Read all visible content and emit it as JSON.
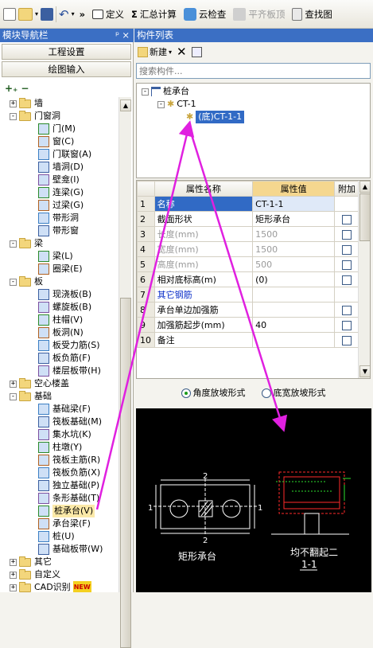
{
  "toolbar": {
    "more": "»",
    "define": "定义",
    "sum_calc": "汇总计算",
    "cloud_check": "云检查",
    "flush_slab_top": "平齐板顶",
    "find_replace": "查找图"
  },
  "left_panel": {
    "title": "模块导航栏",
    "pin": "ᵖ",
    "close": "×",
    "project_settings": "工程设置",
    "drawing_input": "绘图输入",
    "tree": [
      {
        "type": "folder",
        "expand": "+",
        "label": "墙"
      },
      {
        "type": "folder",
        "expand": "-",
        "label": "门窗洞"
      },
      {
        "type": "item",
        "label": "门(M)"
      },
      {
        "type": "item",
        "label": "窗(C)"
      },
      {
        "type": "item",
        "label": "门联窗(A)"
      },
      {
        "type": "item",
        "label": "墙洞(D)"
      },
      {
        "type": "item",
        "label": "壁龛(I)"
      },
      {
        "type": "item",
        "label": "连梁(G)"
      },
      {
        "type": "item",
        "label": "过梁(G)"
      },
      {
        "type": "item",
        "label": "带形洞"
      },
      {
        "type": "item",
        "label": "带形窗"
      },
      {
        "type": "folder",
        "expand": "-",
        "label": "梁"
      },
      {
        "type": "item",
        "label": "梁(L)"
      },
      {
        "type": "item",
        "label": "圈梁(E)"
      },
      {
        "type": "folder",
        "expand": "-",
        "label": "板"
      },
      {
        "type": "item",
        "label": "现浇板(B)"
      },
      {
        "type": "item",
        "label": "螺旋板(B)"
      },
      {
        "type": "item",
        "label": "柱帽(V)"
      },
      {
        "type": "item",
        "label": "板洞(N)"
      },
      {
        "type": "item",
        "label": "板受力筋(S)"
      },
      {
        "type": "item",
        "label": "板负筋(F)"
      },
      {
        "type": "item",
        "label": "楼层板带(H)"
      },
      {
        "type": "folder",
        "expand": "+",
        "label": "空心楼盖"
      },
      {
        "type": "folder",
        "expand": "-",
        "label": "基础"
      },
      {
        "type": "item",
        "label": "基础梁(F)"
      },
      {
        "type": "item",
        "label": "筏板基础(M)"
      },
      {
        "type": "item",
        "label": "集水坑(K)"
      },
      {
        "type": "item",
        "label": "柱墩(Y)"
      },
      {
        "type": "item",
        "label": "筏板主筋(R)"
      },
      {
        "type": "item",
        "label": "筏板负筋(X)"
      },
      {
        "type": "item",
        "label": "独立基础(P)"
      },
      {
        "type": "item",
        "label": "条形基础(T)"
      },
      {
        "type": "item",
        "label": "桩承台(V)",
        "selected": true
      },
      {
        "type": "item",
        "label": "承台梁(F)"
      },
      {
        "type": "item",
        "label": "桩(U)"
      },
      {
        "type": "item",
        "label": "基础板带(W)"
      },
      {
        "type": "folder",
        "expand": "+",
        "label": "其它"
      },
      {
        "type": "folder",
        "expand": "+",
        "label": "自定义"
      },
      {
        "type": "folder",
        "expand": "+",
        "label": "CAD识别",
        "badge": "NEW"
      }
    ]
  },
  "component_list": {
    "title": "构件列表",
    "new_label": "新建",
    "search_placeholder": "搜索构件...",
    "tree": {
      "root": "桩承台",
      "child": "CT-1",
      "leaf": "(底)CT-1-1"
    }
  },
  "properties": {
    "headers": [
      "属性名称",
      "属性值",
      "附加"
    ],
    "rows": [
      {
        "n": "1",
        "name": "名称",
        "value": "CT-1-1",
        "style": "sel",
        "cb": false
      },
      {
        "n": "2",
        "name": "截面形状",
        "value": "矩形承台",
        "style": "",
        "cb": true
      },
      {
        "n": "3",
        "name": "长度(mm)",
        "value": "1500",
        "style": "gray",
        "cb": true
      },
      {
        "n": "4",
        "name": "宽度(mm)",
        "value": "1500",
        "style": "gray",
        "cb": true
      },
      {
        "n": "5",
        "name": "高度(mm)",
        "value": "500",
        "style": "gray",
        "cb": true
      },
      {
        "n": "6",
        "name": "相对底标高(m)",
        "value": "(0)",
        "style": "",
        "cb": true
      },
      {
        "n": "7",
        "name": "其它钢筋",
        "value": "",
        "style": "blue",
        "cb": false
      },
      {
        "n": "8",
        "name": "承台单边加强筋",
        "value": "",
        "style": "",
        "cb": true
      },
      {
        "n": "9",
        "name": "加强筋起步(mm)",
        "value": "40",
        "style": "",
        "cb": true
      },
      {
        "n": "10",
        "name": "备注",
        "value": "",
        "style": "",
        "cb": true
      }
    ]
  },
  "slope": {
    "option1": "角度放坡形式",
    "option2": "底宽放坡形式",
    "selected": "option1"
  },
  "drawing": {
    "plan_label": "矩形承台",
    "dim_top": "2",
    "dim_left": "1",
    "dim_right": "1",
    "dim_bottom": "2",
    "section_caption": "均不翻起二",
    "section_id": "1-1"
  }
}
